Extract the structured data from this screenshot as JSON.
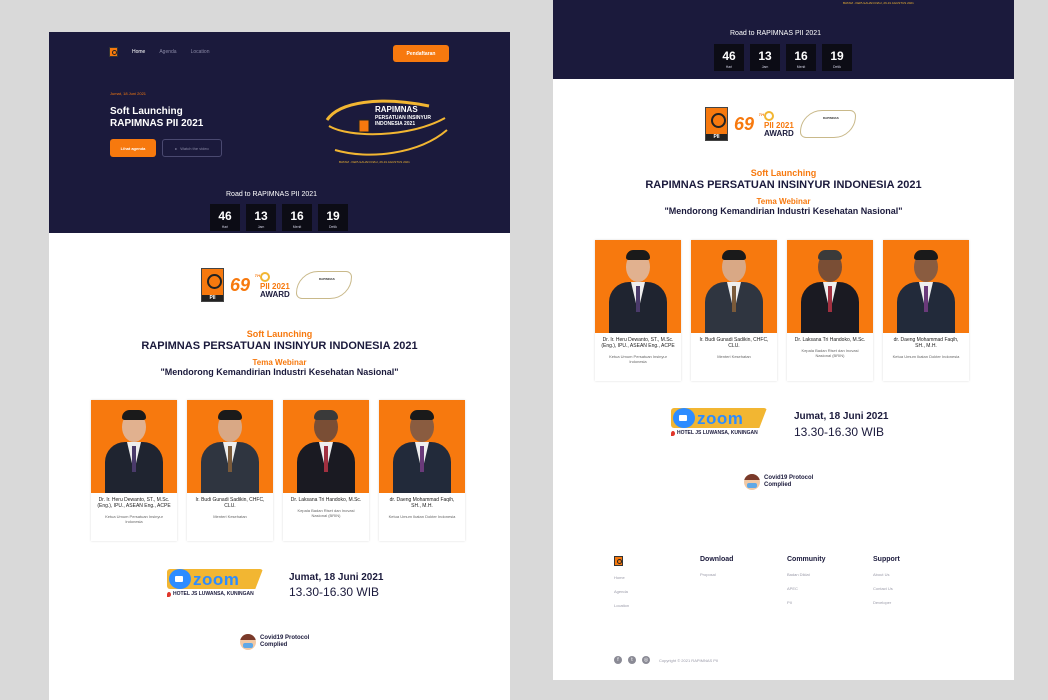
{
  "nav": {
    "links": [
      "Home",
      "Agenda",
      "Location"
    ],
    "register_label": "Pendaftaran"
  },
  "hero": {
    "date": "Jumat, 18 Juni 2021",
    "title_line1": "Soft Launching",
    "title_line2": "RAPIMNAS PII 2021",
    "agenda_label": "Lihat agenda",
    "video_label": "Watch the video"
  },
  "rapimnas_logo": {
    "title": "RAPIMNAS",
    "subtitle": "PERSATUAN INSINYUR INDONESIA 2021",
    "caption": "BATAM - KEPULAUAN RIAU, 26-31 AGUSTUS 2021"
  },
  "countdown": {
    "title": "Road to RAPIMNAS PII 2021",
    "units": [
      {
        "value": "46",
        "label": "Hari"
      },
      {
        "value": "13",
        "label": "Jam"
      },
      {
        "value": "16",
        "label": "Menit"
      },
      {
        "value": "19",
        "label": "Detik"
      }
    ]
  },
  "logos": {
    "pii": "PII",
    "anniversary": "69",
    "anniversary_sup": "TH",
    "award_year": "PII 2021",
    "award_word": "AWARD"
  },
  "event": {
    "kicker": "Soft Launching",
    "title": "RAPIMNAS PERSATUAN INSINYUR INDONESIA 2021",
    "theme_label": "Tema Webinar",
    "theme": "\"Mendorong Kemandirian Industri Kesehatan Nasional\""
  },
  "speakers": [
    {
      "name": "Dr. Ir. Heru Dewanto, ST., M.Sc.(Eng.), IPU., ASEAN Eng., ACPE",
      "role": "Ketua Umum Persatuan Insinyur Indonesia"
    },
    {
      "name": "Ir. Budi Gunadi Sadikin, CHFC, CLU.",
      "role": "Menteri Kesehatan"
    },
    {
      "name": "Dr. Laksana Tri Handoko, M.Sc.",
      "role": "Kepala Badan Riset dan Inovasi Nasional (BRIN)"
    },
    {
      "name": "dr. Daeng Mohammad Faqih, SH., M.H.",
      "role": "Ketua Umum Ikatan Dokter Indonesia"
    }
  ],
  "venue": {
    "zoom_word": "zoom",
    "location": "HOTEL JS LUWANSA, KUNINGAN",
    "date": "Jumat, 18 Juni 2021",
    "time": "13.30-16.30 WIB"
  },
  "covid": {
    "line1": "Covid19 Protocol",
    "line2": "Complied"
  },
  "footer": {
    "col1": [
      "Home",
      "Agenda",
      "Location"
    ],
    "download_title": "Download",
    "download_links": [
      "Proposal"
    ],
    "community_title": "Community",
    "community_links": [
      "Badan Diklat",
      "APEC",
      "PII"
    ],
    "support_title": "Support",
    "support_links": [
      "About Us",
      "Contact Us",
      "Developer"
    ],
    "copyright": "Copyright © 2021 RAPIMNAS PII"
  },
  "colors": {
    "navy": "#1b1a3c",
    "accent": "#f7790e",
    "gold": "#f2b632"
  }
}
